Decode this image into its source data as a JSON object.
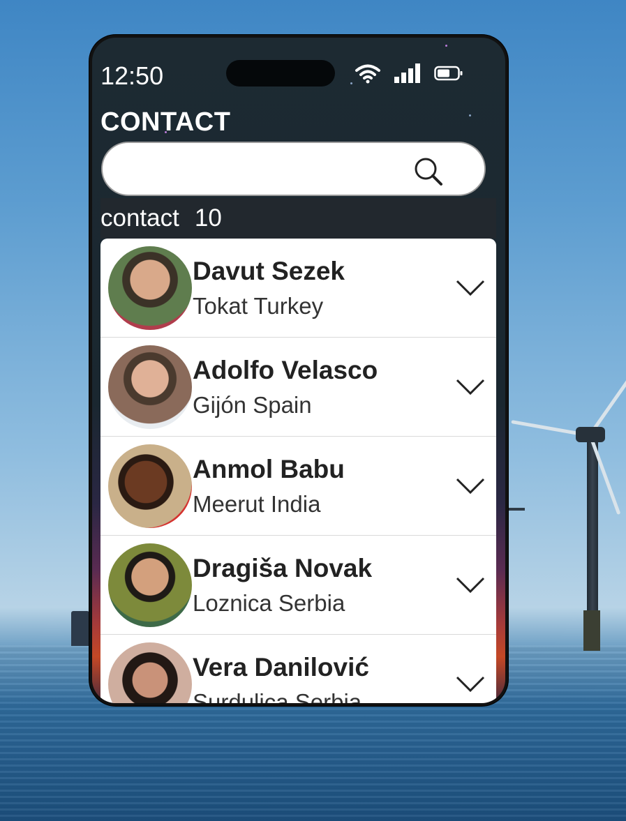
{
  "status": {
    "time": "12:50"
  },
  "header": {
    "title": "CONTACT"
  },
  "search": {
    "placeholder": "",
    "value": ""
  },
  "count": {
    "label": "contact",
    "value": "10"
  },
  "contacts": [
    {
      "name": "Davut Sezek",
      "location": "Tokat Turkey"
    },
    {
      "name": "Adolfo Velasco",
      "location": "Gijón Spain"
    },
    {
      "name": "Anmol Babu",
      "location": "Meerut India"
    },
    {
      "name": "Dragiša Novak",
      "location": "Loznica Serbia"
    },
    {
      "name": "Vera Danilović",
      "location": "Surdulica Serbia"
    }
  ],
  "icons": {
    "wifi": "wifi-icon",
    "signal": "signal-icon",
    "battery": "battery-icon",
    "search": "search-icon",
    "expand": "chevron-down-icon"
  },
  "colors": {
    "list_bg": "#ffffff",
    "count_bar_bg": "#22282e",
    "text_primary": "#222222"
  }
}
